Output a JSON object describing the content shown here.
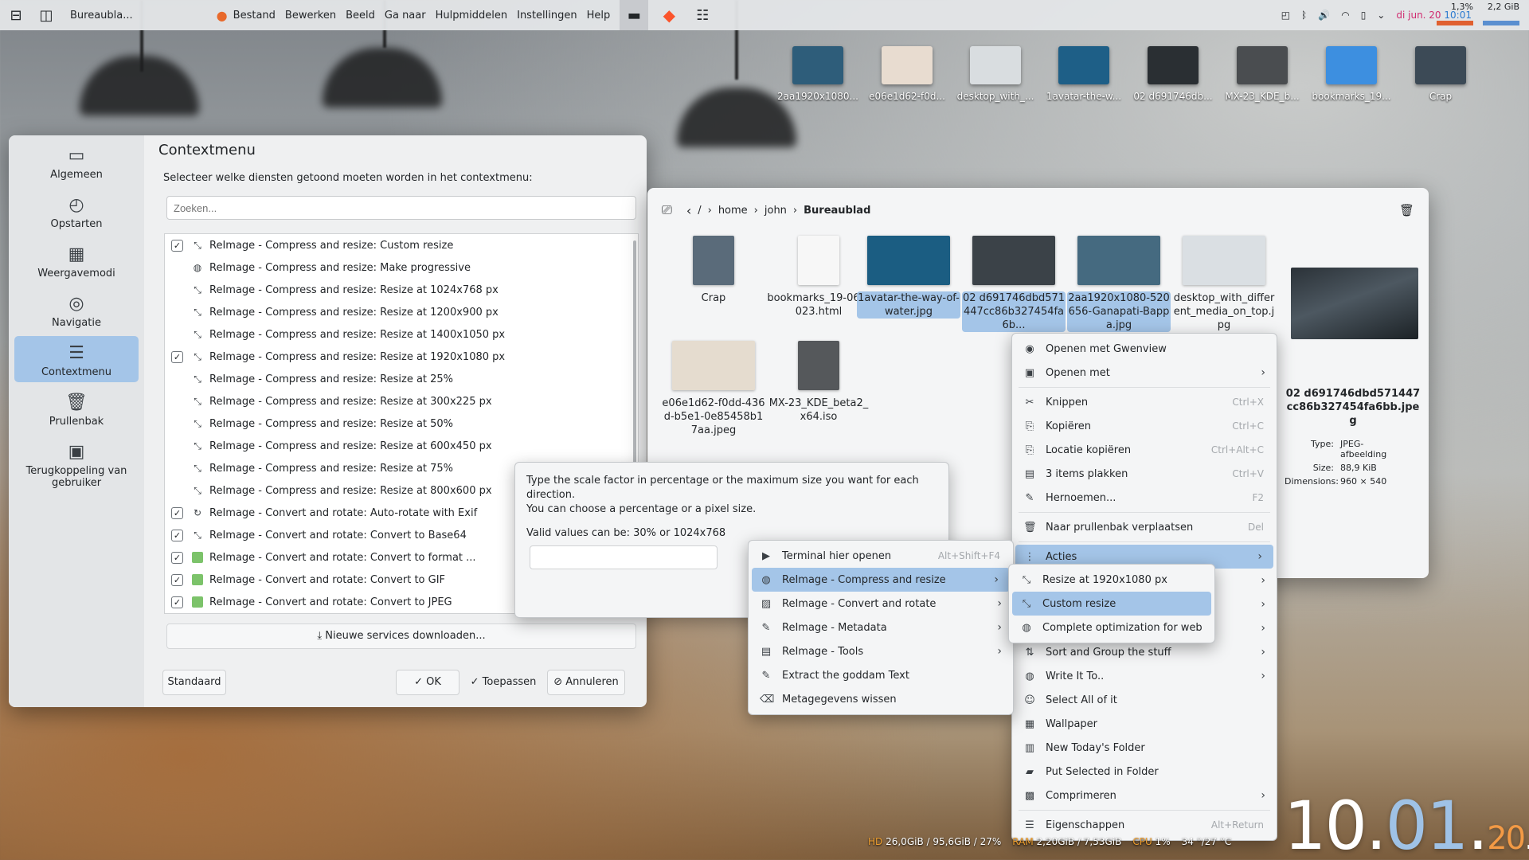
{
  "panel": {
    "app_title": "Bureaubla...",
    "menu": [
      "Bestand",
      "Bewerken",
      "Beeld",
      "Ga naar",
      "Hulpmiddelen",
      "Instellingen",
      "Help"
    ],
    "date": "di jun. 20",
    "time": "10:01",
    "cpu": "1,3%",
    "mem": "2,2 GiB"
  },
  "desktop_icons": [
    {
      "label": "2aa1920x1080...",
      "color": "#2e5d7a"
    },
    {
      "label": "e06e1d62-f0d...",
      "color": "#e8dcd0"
    },
    {
      "label": "desktop_with_...",
      "color": "#d9dde0"
    },
    {
      "label": "1avatar-the-w...",
      "color": "#1e5f87"
    },
    {
      "label": "02 d691746db...",
      "color": "#2a2f33"
    },
    {
      "label": "MX-23_KDE_b...",
      "color": "#4a4d50"
    },
    {
      "label": "bookmarks_19...",
      "color": "#3d8fe0"
    },
    {
      "label": "Crap",
      "color": "#3c4a56"
    }
  ],
  "settings": {
    "sidebar": [
      {
        "label": "Algemeen",
        "icon": "folder-icon"
      },
      {
        "label": "Opstarten",
        "icon": "startup-icon"
      },
      {
        "label": "Weergavemodi",
        "icon": "view-modes-icon"
      },
      {
        "label": "Navigatie",
        "icon": "compass-icon"
      },
      {
        "label": "Contextmenu",
        "icon": "context-menu-icon"
      },
      {
        "label": "Prullenbak",
        "icon": "trash-icon"
      },
      {
        "label": "Terugkoppeling van gebruiker",
        "icon": "feedback-icon"
      }
    ],
    "title": "Contextmenu",
    "description": "Selecteer welke diensten getoond moeten worden in het contextmenu:",
    "search_placeholder": "Zoeken...",
    "services": [
      {
        "label": "ReImage - Compress and resize: Custom resize",
        "checked": true,
        "icon": "resize"
      },
      {
        "label": "ReImage - Compress and resize: Make progressive",
        "checked": false,
        "icon": "globe"
      },
      {
        "label": "ReImage - Compress and resize: Resize at 1024x768 px",
        "checked": false,
        "icon": "resize"
      },
      {
        "label": "ReImage - Compress and resize: Resize at 1200x900 px",
        "checked": false,
        "icon": "resize"
      },
      {
        "label": "ReImage - Compress and resize: Resize at 1400x1050 px",
        "checked": false,
        "icon": "resize"
      },
      {
        "label": "ReImage - Compress and resize: Resize at 1920x1080 px",
        "checked": true,
        "icon": "resize"
      },
      {
        "label": "ReImage - Compress and resize: Resize at 25%",
        "checked": false,
        "icon": "resize"
      },
      {
        "label": "ReImage - Compress and resize: Resize at 300x225 px",
        "checked": false,
        "icon": "resize"
      },
      {
        "label": "ReImage - Compress and resize: Resize at 50%",
        "checked": false,
        "icon": "resize"
      },
      {
        "label": "ReImage - Compress and resize: Resize at 600x450 px",
        "checked": false,
        "icon": "resize"
      },
      {
        "label": "ReImage - Compress and resize: Resize at 75%",
        "checked": false,
        "icon": "resize"
      },
      {
        "label": "ReImage - Compress and resize: Resize at 800x600 px",
        "checked": false,
        "icon": "resize"
      },
      {
        "label": "ReImage - Convert and rotate: Auto-rotate with Exif",
        "checked": true,
        "icon": "rotate"
      },
      {
        "label": "ReImage - Convert and rotate: Convert to Base64",
        "checked": true,
        "icon": "resize"
      },
      {
        "label": "ReImage - Convert and rotate: Convert to format ...",
        "checked": true,
        "icon": "image"
      },
      {
        "label": "ReImage - Convert and rotate: Convert to GIF",
        "checked": true,
        "icon": "image"
      },
      {
        "label": "ReImage - Convert and rotate: Convert to JPEG",
        "checked": true,
        "icon": "image"
      }
    ],
    "download_label": "Nieuwe services downloaden...",
    "default_label": "Standaard",
    "ok_label": "OK",
    "apply_label": "Toepassen",
    "cancel_label": "Annuleren"
  },
  "dolphin": {
    "breadcrumb": [
      "/",
      "home",
      "john",
      "Bureaublad"
    ],
    "files": [
      {
        "label": "Crap",
        "color": "#5a6b7a",
        "selected": false
      },
      {
        "label": "bookmarks_19-06-2023.html",
        "color": "#f7f7f7",
        "selected": false
      },
      {
        "label": "1avatar-the-way-of-water.jpg",
        "color": "#1b5d82",
        "selected": true
      },
      {
        "label": "02 d691746dbd571447cc86b327454fa6b...",
        "color": "#3b4248",
        "selected": true
      },
      {
        "label": "2aa1920x1080-520656-Ganapati-Bappa.jpg",
        "color": "#456a80",
        "selected": true
      },
      {
        "label": "desktop_with_different_media_on_top.jpg",
        "color": "#dadfe3",
        "selected": false
      },
      {
        "label": "e06e1d62-f0dd-436d-b5e1-0e85458b17aa.jpeg",
        "color": "#e5dccf",
        "selected": false
      },
      {
        "label": "MX-23_KDE_beta2_x64.iso",
        "color": "#55585b",
        "selected": false
      }
    ],
    "preview": {
      "name": "02 d691746dbd571447cc86b327454fa6bb.jpeg",
      "type_label": "Type:",
      "type_value": "JPEG-afbeelding",
      "size_label": "Size:",
      "size_value": "88,9 KiB",
      "dim_label": "Dimensions:",
      "dim_value": "960 × 540"
    }
  },
  "context_menu": [
    {
      "label": "Openen met Gwenview",
      "shortcut": "",
      "arrow": false,
      "icon": "gwenview-icon",
      "glyph": "◉"
    },
    {
      "label": "Openen met",
      "shortcut": "",
      "arrow": true,
      "icon": "open-with-icon",
      "glyph": "▣"
    },
    {
      "sep": true
    },
    {
      "label": "Knippen",
      "shortcut": "Ctrl+X",
      "arrow": false,
      "icon": "scissors-icon",
      "glyph": "✂"
    },
    {
      "label": "Kopiëren",
      "shortcut": "Ctrl+C",
      "arrow": false,
      "icon": "copy-icon",
      "glyph": "⎘"
    },
    {
      "label": "Locatie kopiëren",
      "shortcut": "Ctrl+Alt+C",
      "arrow": false,
      "icon": "copy-location-icon",
      "glyph": "⎘"
    },
    {
      "label": "3 items plakken",
      "shortcut": "Ctrl+V",
      "arrow": false,
      "icon": "paste-icon",
      "glyph": "▤"
    },
    {
      "label": "Hernoemen...",
      "shortcut": "F2",
      "arrow": false,
      "icon": "rename-icon",
      "glyph": "✎"
    },
    {
      "sep": true
    },
    {
      "label": "Naar prullenbak verplaatsen",
      "shortcut": "Del",
      "arrow": false,
      "icon": "trash-icon",
      "glyph": "🗑"
    },
    {
      "sep": true
    },
    {
      "label": "Acties",
      "shortcut": "",
      "arrow": true,
      "icon": "actions-icon",
      "glyph": "⋮",
      "hl": true
    },
    {
      "label": "",
      "shortcut": "",
      "arrow": true,
      "icon": "",
      "glyph": ""
    },
    {
      "label": "",
      "shortcut": "",
      "arrow": true,
      "icon": "",
      "glyph": ""
    },
    {
      "label": "",
      "shortcut": "",
      "arrow": true,
      "icon": "",
      "glyph": ""
    },
    {
      "label": "Sort and Group the stuff",
      "shortcut": "",
      "arrow": true,
      "icon": "sort-icon",
      "glyph": "⇅"
    },
    {
      "label": "Write It To..",
      "shortcut": "",
      "arrow": true,
      "icon": "write-icon",
      "glyph": "◍"
    },
    {
      "label": "Select All of it",
      "shortcut": "",
      "arrow": false,
      "icon": "select-all-icon",
      "glyph": "☺"
    },
    {
      "label": "Wallpaper",
      "shortcut": "",
      "arrow": false,
      "icon": "wallpaper-icon",
      "glyph": "▦"
    },
    {
      "label": "New Today's Folder",
      "shortcut": "",
      "arrow": false,
      "icon": "calendar-icon",
      "glyph": "▥"
    },
    {
      "label": "Put Selected in Folder",
      "shortcut": "",
      "arrow": false,
      "icon": "folder-put-icon",
      "glyph": "▰"
    },
    {
      "label": "Comprimeren",
      "shortcut": "",
      "arrow": true,
      "icon": "compress-icon",
      "glyph": "▩"
    },
    {
      "sep": true
    },
    {
      "label": "Eigenschappen",
      "shortcut": "Alt+Return",
      "arrow": false,
      "icon": "properties-icon",
      "glyph": "☰"
    }
  ],
  "actions_menu": [
    {
      "label": "Terminal hier openen",
      "shortcut": "Alt+Shift+F4",
      "arrow": false,
      "icon": "terminal-icon",
      "glyph": "▶"
    },
    {
      "label": "ReImage - Compress and resize",
      "shortcut": "",
      "arrow": true,
      "icon": "globe-icon",
      "glyph": "◍",
      "hl": true
    },
    {
      "label": "ReImage - Convert and rotate",
      "shortcut": "",
      "arrow": true,
      "icon": "image-icon",
      "glyph": "▨"
    },
    {
      "label": "ReImage - Metadata",
      "shortcut": "",
      "arrow": true,
      "icon": "pen-icon",
      "glyph": "✎"
    },
    {
      "label": "ReImage - Tools",
      "shortcut": "",
      "arrow": true,
      "icon": "tools-icon",
      "glyph": "▤"
    },
    {
      "label": "Extract the goddam Text",
      "shortcut": "",
      "arrow": false,
      "icon": "extract-icon",
      "glyph": "✎"
    },
    {
      "label": "Metagegevens wissen",
      "shortcut": "",
      "arrow": false,
      "icon": "erase-icon",
      "glyph": "⌫"
    }
  ],
  "resize_menu": [
    {
      "label": "Resize at 1920x1080 px",
      "icon": "resize-icon",
      "glyph": "⤡",
      "hl": false
    },
    {
      "label": "Custom resize",
      "icon": "resize-icon",
      "glyph": "⤡",
      "hl": true
    },
    {
      "label": "Complete optimization for web",
      "icon": "globe-icon",
      "glyph": "◍",
      "hl": false
    }
  ],
  "tooltip": {
    "line1": "Type the scale factor in percentage or the maximum size you want for each direction.",
    "line2": "You can choose a percentage or a pixel size.",
    "line3": "Valid values can be: 30% or 1024x768"
  },
  "statusbar": {
    "hd_label": "HD",
    "hd_value": "26,0GiB / 95,6GiB / 27%",
    "ram_label": "RAM",
    "ram_value": "2,20GiB / 7,53GiB",
    "cpu_label": "CPU",
    "cpu_value": "1%",
    "temp_value": "34 °/27 °C"
  },
  "clock": {
    "hour": "10",
    "minute": "01",
    "day": "20",
    "weekday": "di"
  }
}
